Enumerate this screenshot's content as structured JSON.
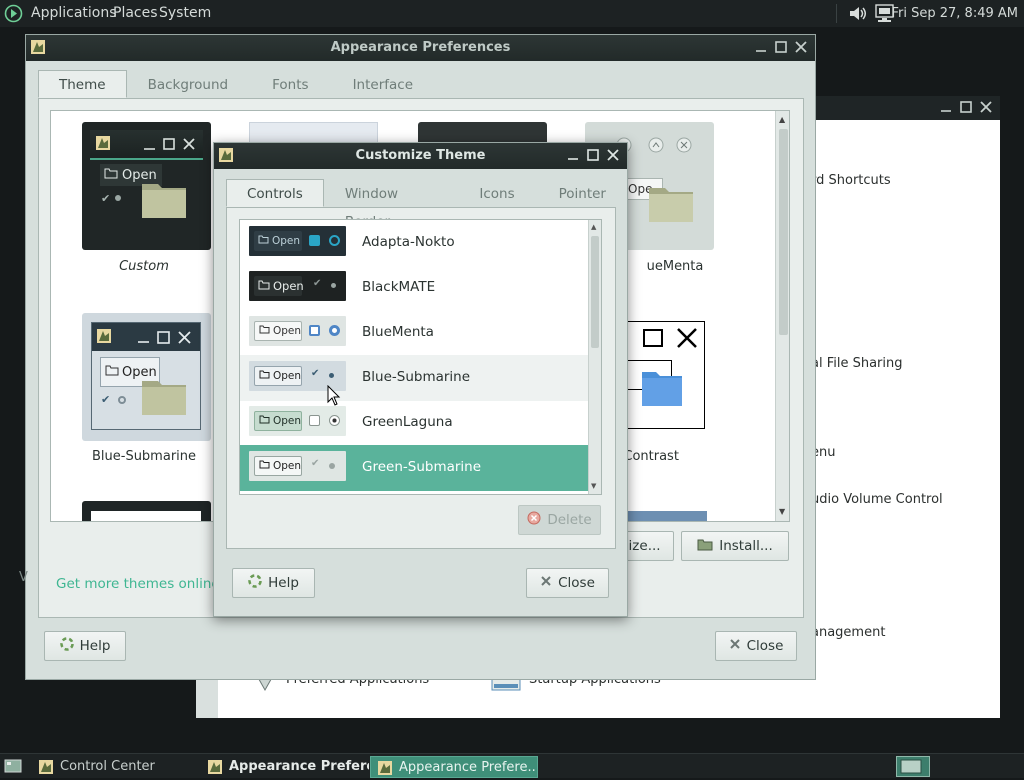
{
  "top_panel": {
    "menu": [
      "Applications",
      "Places",
      "System"
    ],
    "clock": "Fri Sep 27,  8:49 AM"
  },
  "control_center": {
    "items": [
      "rd Shortcuts",
      "al File Sharing",
      "enu",
      "udio Volume Control",
      "anagement",
      "Preferred Applications",
      "Startup Applications"
    ]
  },
  "appearance": {
    "title": "Appearance Preferences",
    "tabs": [
      "Theme",
      "Background",
      "Fonts",
      "Interface"
    ],
    "themes": [
      {
        "label": "Custom",
        "button": "Open"
      },
      {
        "label": "ueMenta",
        "button": "Ope"
      },
      {
        "label": "Blue-Submarine",
        "button": "Open"
      },
      {
        "label": "h Contrast",
        "button": ""
      }
    ],
    "more_themes_link": "Get more themes online",
    "customize_label": "mize...",
    "install_label": "Install...",
    "help_label": "Help",
    "close_label": "Close",
    "left_edge_text": "V"
  },
  "customize": {
    "title": "Customize Theme",
    "tabs": [
      "Controls",
      "Window Border",
      "Icons",
      "Pointer"
    ],
    "themes": [
      {
        "name": "Adapta-Nokto"
      },
      {
        "name": "BlackMATE"
      },
      {
        "name": "BlueMenta"
      },
      {
        "name": "Blue-Submarine"
      },
      {
        "name": "GreenLaguna"
      },
      {
        "name": "Green-Submarine"
      }
    ],
    "preview_open_label": "Open",
    "delete_label": "Delete",
    "help_label": "Help",
    "close_label": "Close",
    "selected_index": 5
  },
  "taskbar": {
    "items": [
      "Control Center",
      "Appearance Prefere...",
      "Appearance Prefere..."
    ]
  },
  "colors": {
    "accent": "#5ab39b",
    "link": "#3fb692",
    "titlebar": "#262e2d"
  }
}
